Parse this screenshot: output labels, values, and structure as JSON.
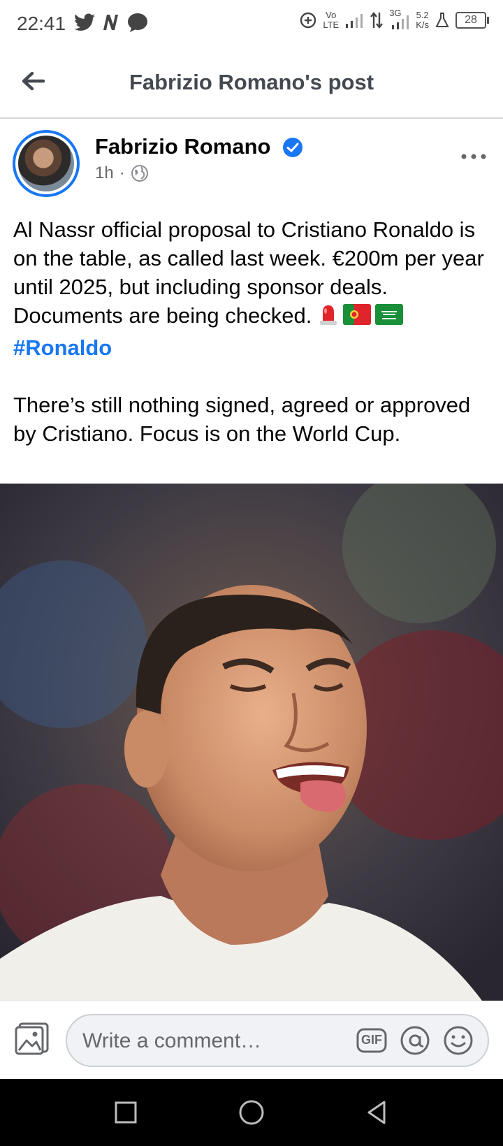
{
  "status_bar": {
    "time": "22:41",
    "network_top": "Vo",
    "network_bottom": "LTE",
    "net_gen": "3G",
    "speed_value": "5.2",
    "speed_unit": "K/s",
    "battery": "28",
    "icons": [
      "twitter-icon",
      "n-app-icon",
      "messenger-icon",
      "data-saver-icon",
      "signal-icon",
      "data-arrows-icon",
      "lab-icon",
      "battery-icon"
    ]
  },
  "header": {
    "title": "Fabrizio Romano's post",
    "back_icon": "arrow-left-icon"
  },
  "post": {
    "author": "Fabrizio Romano",
    "time": "1h",
    "separator": "·",
    "audience_icon": "globe-icon",
    "verified_icon": "verified-badge-icon",
    "more_icon": "more-dots-icon",
    "text_part1": "Al Nassr official proposal to Cristiano Ronaldo is on the table, as called last week. €200m per year until 2025, but including sponsor deals. Documents are being checked. ",
    "emojis": [
      "siren-emoji",
      "portugal-flag-emoji",
      "saudi-flag-emoji"
    ],
    "hashtag": "#Ronaldo",
    "text_part2": "There’s still nothing signed, agreed or approved by Cristiano. Focus is on the World Cup."
  },
  "comment_bar": {
    "placeholder": "Write a comment…",
    "gif_label": "GIF",
    "icons": [
      "photo-icon",
      "gif-icon",
      "at-icon",
      "smile-icon"
    ]
  },
  "nav_bar": {
    "icons": [
      "recents-icon",
      "home-icon",
      "back-icon"
    ]
  },
  "colors": {
    "accent": "#1877f2",
    "text": "#050505",
    "secondary_text": "#65676b",
    "header_text": "#444950"
  }
}
